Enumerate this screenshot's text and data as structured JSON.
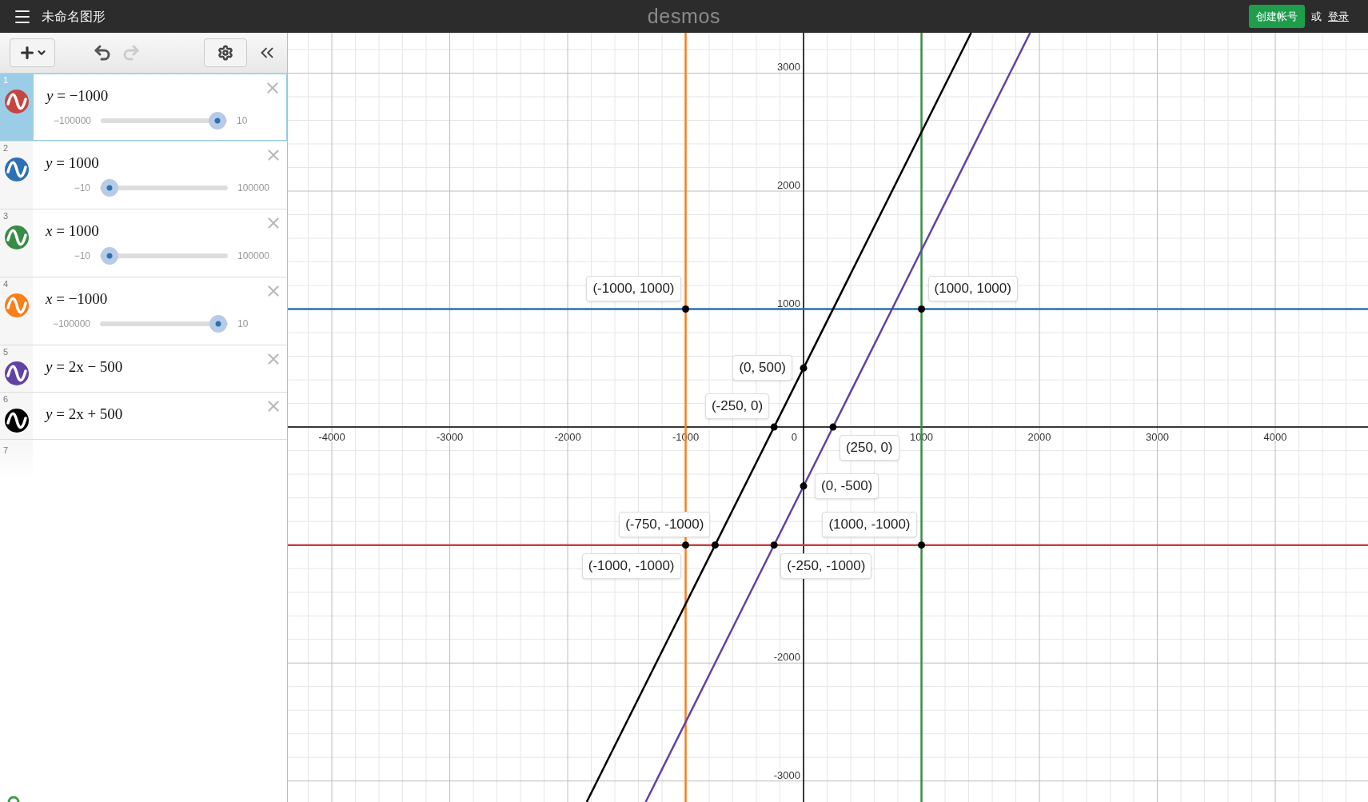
{
  "top_bar": {
    "title": "未命名图形",
    "logo": "desmos",
    "signup_button": "创建帐号",
    "or_text": "或",
    "login_link": "登录"
  },
  "toolbar": {
    "undo": {
      "disabled": false
    },
    "redo": {
      "disabled": true
    }
  },
  "expressions": [
    {
      "index": "1",
      "color": "#c74440",
      "selected": true,
      "text": "*y* = −1000",
      "slider": {
        "min": "−100000",
        "max": "10",
        "level": 0.99
      }
    },
    {
      "index": "2",
      "color": "#2d70b3",
      "selected": false,
      "text": "*y* = 1000",
      "slider": {
        "min": "−10",
        "max": "100000",
        "level": 0.01
      }
    },
    {
      "index": "3",
      "color": "#388c46",
      "selected": false,
      "text": "*x* = 1000",
      "slider": {
        "min": "−10",
        "max": "100000",
        "level": 0.01
      }
    },
    {
      "index": "4",
      "color": "#fa7e19",
      "selected": false,
      "text": "*x* = −1000",
      "slider": {
        "min": "−100000",
        "max": "10",
        "level": 0.99
      }
    },
    {
      "index": "5",
      "color": "#6042a6",
      "selected": false,
      "text": "*y* = 2x − 500"
    },
    {
      "index": "6",
      "color": "#000000",
      "selected": false,
      "text": "*y* = 2x + 500"
    }
  ],
  "new_row_index": "7",
  "graph": {
    "chart_data": {
      "type": "line",
      "xlim": [
        -4373,
        4786
      ],
      "ylim": [
        -3178,
        3342
      ],
      "xticks": [
        -4000,
        -3000,
        -2000,
        -1000,
        1000,
        2000,
        3000,
        4000
      ],
      "yticks": [
        -3000,
        -2000,
        1000,
        2000,
        3000
      ],
      "grid": true,
      "series": [
        {
          "color": "#c74440",
          "x": [
            -4373,
            4786
          ],
          "values": [
            -1000,
            -1000
          ]
        },
        {
          "color": "#2d70b3",
          "x": [
            -4373,
            4786
          ],
          "values": [
            1000,
            1000
          ]
        },
        {
          "color": "#388c46",
          "x": [
            1000,
            1000
          ],
          "values": [
            -3178,
            3342
          ]
        },
        {
          "color": "#fa7e19",
          "x": [
            -1000,
            -1000
          ],
          "values": [
            -3178,
            3342
          ]
        },
        {
          "color": "#6042a6",
          "x": [
            -1339,
            1921
          ],
          "values": [
            -3178,
            3342
          ]
        },
        {
          "color": "#000000",
          "x": [
            -1839,
            1421
          ],
          "values": [
            -3178,
            3342
          ]
        }
      ],
      "annotations": [
        {
          "x": -1000,
          "y": 1000,
          "text": "(-1000, 1000)"
        },
        {
          "x": 1000,
          "y": 1000,
          "text": "(1000, 1000)"
        },
        {
          "x": 0,
          "y": 500,
          "text": "(0, 500)"
        },
        {
          "x": -250,
          "y": 0,
          "text": "(-250, 0)"
        },
        {
          "x": 250,
          "y": 0,
          "text": "(250, 0)"
        },
        {
          "x": 0,
          "y": -500,
          "text": "(0, -500)"
        },
        {
          "x": -750,
          "y": -1000,
          "text": "(-750, -1000)"
        },
        {
          "x": 1000,
          "y": -1000,
          "text": "(1000, -1000)"
        },
        {
          "x": -1000,
          "y": -1000,
          "text": "(-1000, -1000)"
        },
        {
          "x": -250,
          "y": -1000,
          "text": "(-250, -1000)"
        }
      ]
    },
    "origin_label": "0"
  }
}
